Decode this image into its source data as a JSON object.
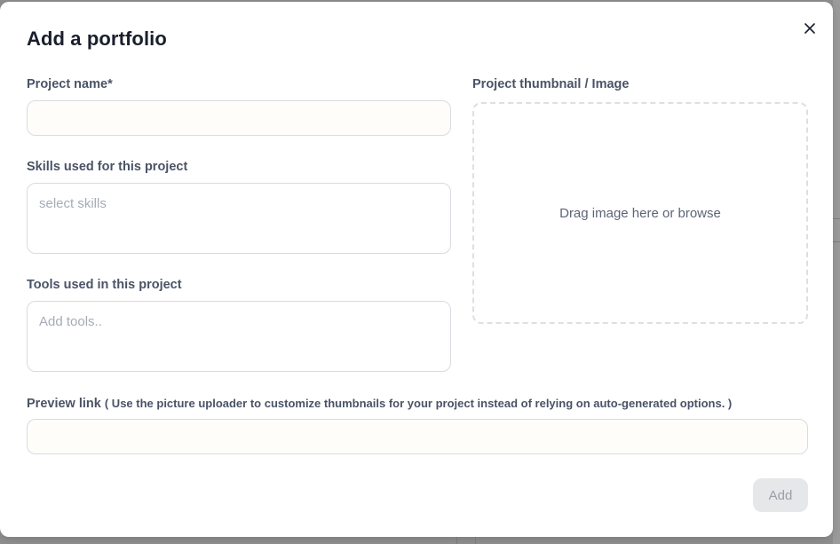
{
  "modal": {
    "title": "Add a portfolio",
    "close_icon": "close-icon"
  },
  "form": {
    "project_name": {
      "label": "Project name*",
      "value": "",
      "placeholder": ""
    },
    "skills": {
      "label": "Skills used for this project",
      "placeholder": "select skills"
    },
    "tools": {
      "label": "Tools used in this project",
      "placeholder": "Add tools.."
    },
    "thumbnail": {
      "label": "Project thumbnail / Image",
      "dropzone_text": "Drag image here or browse"
    },
    "preview_link": {
      "label": "Preview link",
      "hint": "( Use the picture uploader to customize thumbnails for your project instead of relying on auto-generated options. )",
      "value": ""
    },
    "submit_label": "Add"
  },
  "colors": {
    "title_text": "#1a1f2c",
    "label_text": "#4a5366",
    "input_border": "#d9dbe0",
    "disabled_button_bg": "#e6e7e9",
    "disabled_button_text": "#9a9ea6"
  }
}
